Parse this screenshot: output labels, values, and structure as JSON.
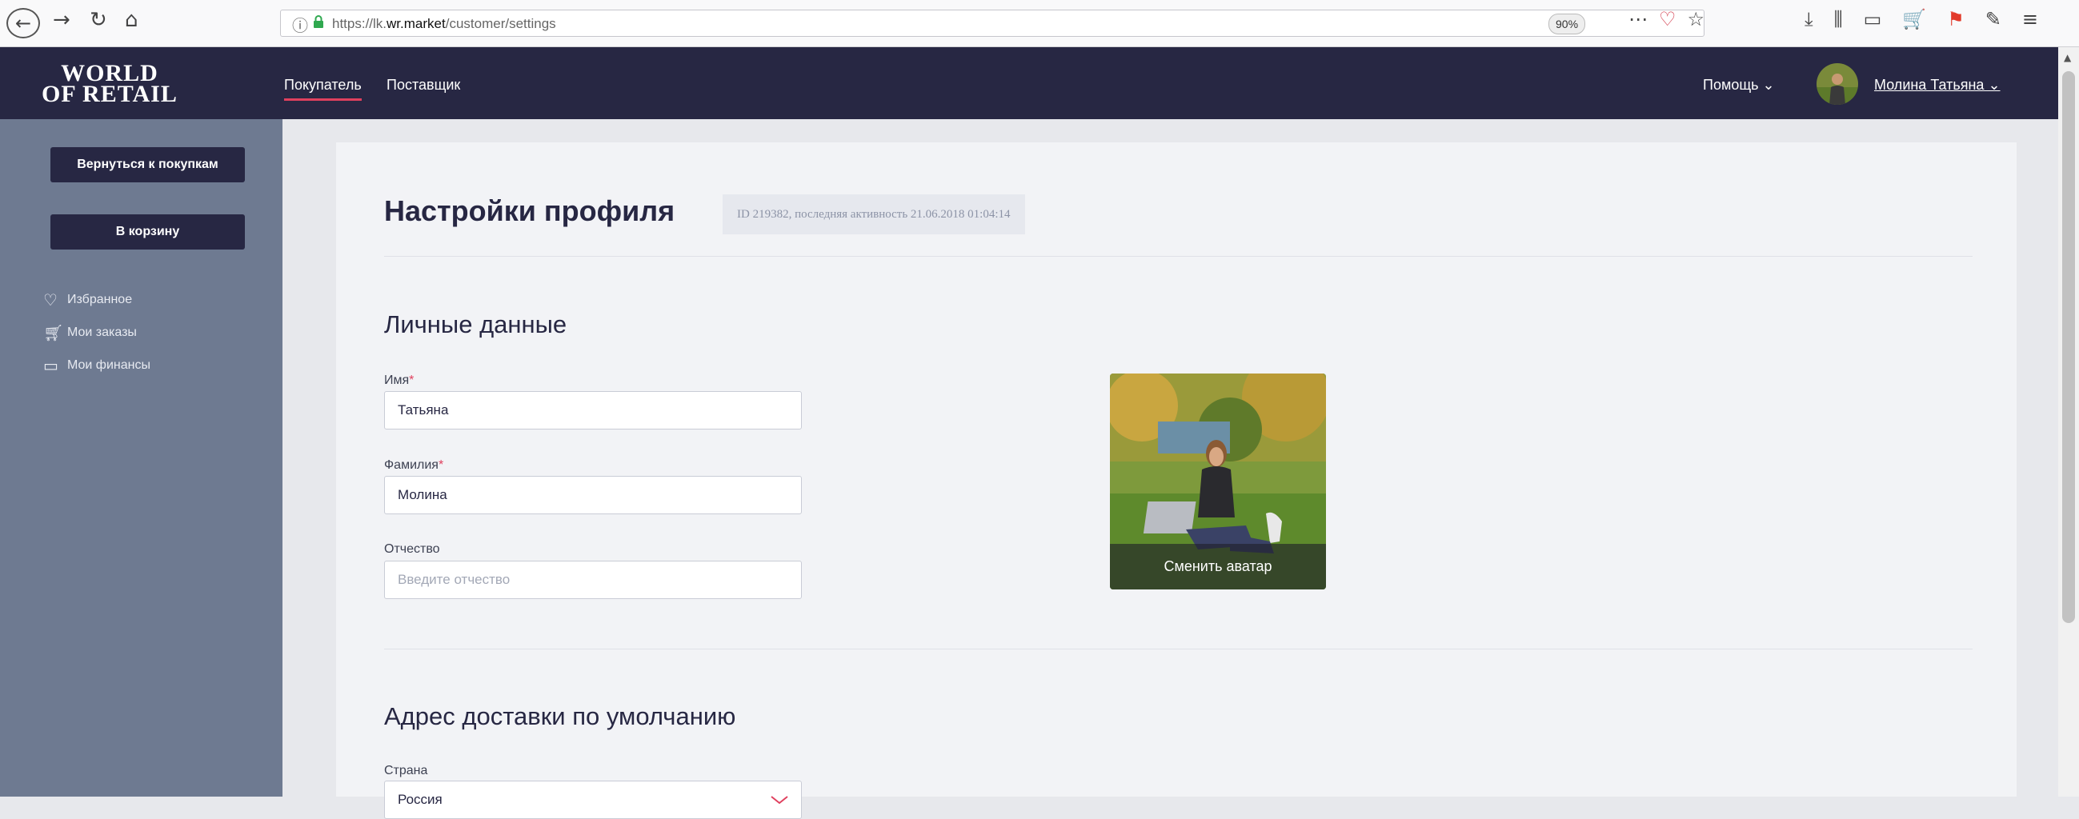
{
  "browser": {
    "url_prefix": "https://lk.",
    "url_domain": "wr.market",
    "url_path": "/customer/settings",
    "zoom": "90%"
  },
  "header": {
    "logo_line1": "WORLD",
    "logo_line2": "OF RETAIL",
    "tabs": [
      {
        "label": "Покупатель"
      },
      {
        "label": "Поставщик"
      }
    ],
    "help": "Помощь ⌄",
    "user_name": "Молина Татьяна ⌄"
  },
  "sidebar": {
    "back_button": "Вернуться к покупкам",
    "cart_button": "В корзину",
    "links": [
      {
        "label": "Избранное",
        "icon": "heart-icon"
      },
      {
        "label": "Мои заказы",
        "icon": "cart-icon"
      },
      {
        "label": "Мои финансы",
        "icon": "wallet-icon"
      }
    ]
  },
  "main": {
    "title": "Настройки профиля",
    "id_badge": "ID 219382, последняя активность 21.06.2018 01:04:14",
    "personal": {
      "title": "Личные данные",
      "first_name_label": "Имя",
      "first_name_value": "Татьяна",
      "last_name_label": "Фамилия",
      "last_name_value": "Молина",
      "middle_name_label": "Отчество",
      "middle_name_placeholder": "Введите отчество",
      "required_mark": "*"
    },
    "avatar": {
      "change_label": "Сменить аватар"
    },
    "delivery": {
      "title": "Адрес доставки по умолчанию",
      "country_label": "Страна",
      "country_value": "Россия"
    }
  },
  "colors": {
    "header_bg": "#272743",
    "sidebar_bg": "#6e7a91",
    "accent": "#e0405e"
  }
}
